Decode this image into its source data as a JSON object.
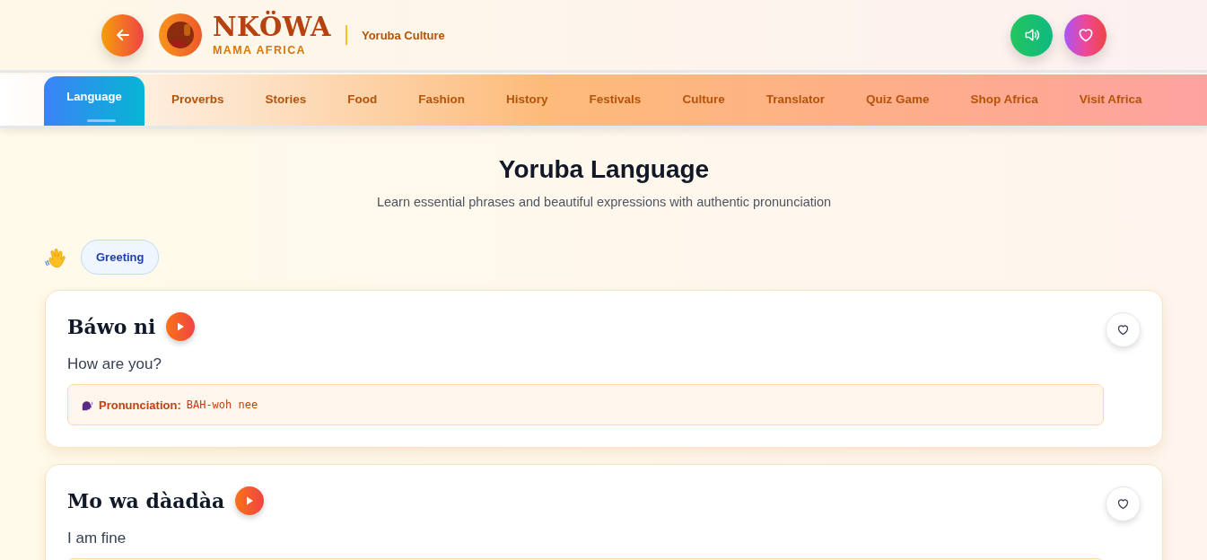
{
  "header": {
    "brand": "NKÖWA",
    "tagline": "MAMA AFRICA",
    "section": "Yoruba Culture"
  },
  "tabs": [
    {
      "label": "Language",
      "selected": true
    },
    {
      "label": "Proverbs",
      "selected": false
    },
    {
      "label": "Stories",
      "selected": false
    },
    {
      "label": "Food",
      "selected": false
    },
    {
      "label": "Fashion",
      "selected": false
    },
    {
      "label": "History",
      "selected": false
    },
    {
      "label": "Festivals",
      "selected": false
    },
    {
      "label": "Culture",
      "selected": false
    },
    {
      "label": "Translator",
      "selected": false
    },
    {
      "label": "Quiz Game",
      "selected": false
    },
    {
      "label": "Shop Africa",
      "selected": false
    },
    {
      "label": "Visit Africa",
      "selected": false
    }
  ],
  "page": {
    "title": "Yoruba Language",
    "subtitle": "Learn essential phrases and beautiful expressions with authentic pronunciation"
  },
  "category": {
    "label": "Greeting"
  },
  "phrases": [
    {
      "phrase": "Báwo ni",
      "translation": "How are you?",
      "pronunciation_label": "Pronunciation:",
      "pronunciation": "BAH-woh nee"
    },
    {
      "phrase": "Mo wa dàadàa",
      "translation": "I am fine"
    }
  ]
}
